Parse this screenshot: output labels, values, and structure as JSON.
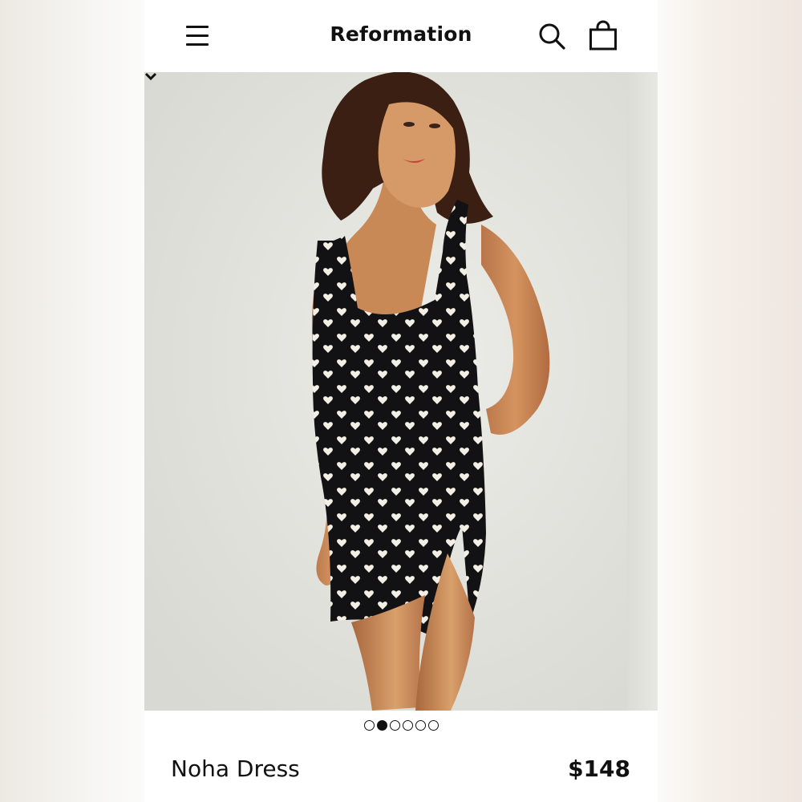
{
  "header": {
    "brand": "Reformation",
    "menu_icon": "hamburger-menu-icon",
    "search_icon": "search-icon",
    "bag_icon": "shopping-bag-icon"
  },
  "gallery": {
    "image_count": 6,
    "active_index": 1,
    "dots": [
      {
        "active": false
      },
      {
        "active": true
      },
      {
        "active": false
      },
      {
        "active": false
      },
      {
        "active": false
      },
      {
        "active": false
      }
    ]
  },
  "product": {
    "name": "Noha Dress",
    "price": "$148"
  },
  "colors": {
    "text": "#111111",
    "background": "#ffffff",
    "photo_backdrop": "#e2e2dd",
    "dress": "#121214",
    "dress_print": "#f3efe4"
  }
}
